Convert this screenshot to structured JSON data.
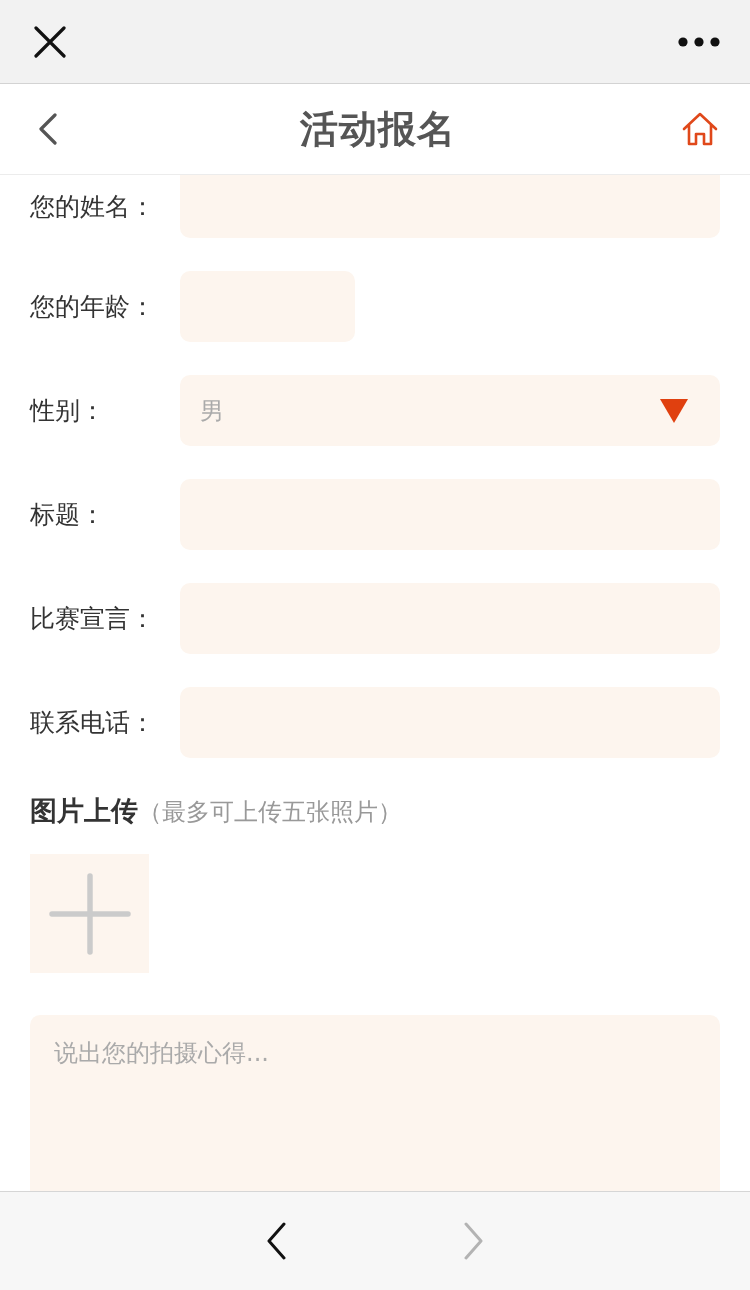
{
  "header": {
    "title": "活动报名"
  },
  "form": {
    "fields": [
      {
        "label": "您的姓名：",
        "kind": "text"
      },
      {
        "label": "您的年龄：",
        "kind": "short"
      },
      {
        "label": "性别：",
        "kind": "select",
        "value": "男"
      },
      {
        "label": "标题：",
        "kind": "text"
      },
      {
        "label": "比赛宣言：",
        "kind": "text"
      },
      {
        "label": "联系电话：",
        "kind": "text"
      }
    ]
  },
  "photo_upload": {
    "title": "图片上传",
    "hint": "（最多可上传五张照片）"
  },
  "comment": {
    "placeholder": "说出您的拍摄心得..."
  },
  "bottom_nav": [
    {
      "kind": "back",
      "disabled": false
    },
    {
      "kind": "forward",
      "disabled": true
    }
  ]
}
